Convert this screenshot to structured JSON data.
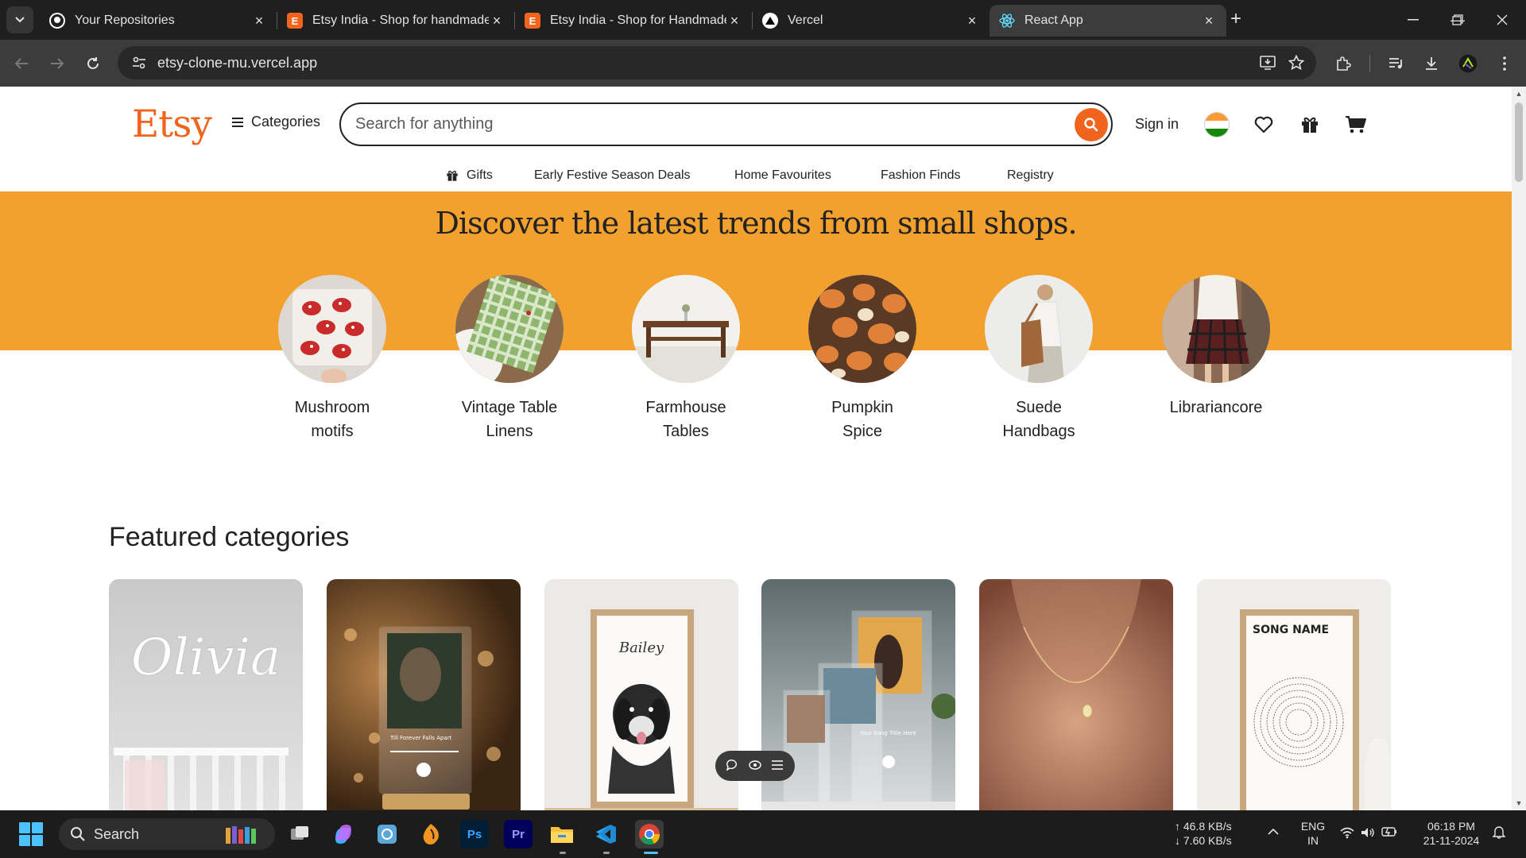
{
  "browser": {
    "tabs": [
      {
        "title": "Your Repositories",
        "favicon": "github-icon",
        "active": false
      },
      {
        "title": "Etsy India - Shop for handmade",
        "favicon": "etsy-icon",
        "active": false
      },
      {
        "title": "Etsy India - Shop for Handmade",
        "favicon": "etsy-icon",
        "active": false
      },
      {
        "title": "Vercel",
        "favicon": "vercel-icon",
        "active": false
      },
      {
        "title": "React App",
        "favicon": "react-icon",
        "active": true
      }
    ],
    "url": "etsy-clone-mu.vercel.app"
  },
  "header": {
    "logo": "Etsy",
    "categories_label": "Categories",
    "search_placeholder": "Search for anything",
    "signin_label": "Sign in"
  },
  "subnav": {
    "items": [
      "Gifts",
      "Early Festive Season Deals",
      "Home Favourites",
      "Fashion Finds",
      "Registry"
    ]
  },
  "hero": {
    "title": "Discover the latest trends from small shops.",
    "trends": [
      {
        "line1": "Mushroom",
        "line2": "motifs"
      },
      {
        "line1": "Vintage Table",
        "line2": "Linens"
      },
      {
        "line1": "Farmhouse",
        "line2": "Tables"
      },
      {
        "line1": "Pumpkin",
        "line2": "Spice"
      },
      {
        "line1": "Suede",
        "line2": "Handbags"
      },
      {
        "line1": "Librariancore",
        "line2": ""
      }
    ]
  },
  "featured": {
    "title": "Featured categories",
    "cards": [
      {
        "name": "name-sign",
        "overlay_text": "Olivia"
      },
      {
        "name": "song-plaque-couple",
        "overlay_text": "Till Forever Falls Apart"
      },
      {
        "name": "pet-portrait",
        "overlay_text": "Bailey"
      },
      {
        "name": "photo-plaques",
        "overlay_text": "Your Song Title Here"
      },
      {
        "name": "necklace",
        "overlay_text": ""
      },
      {
        "name": "song-lyrics-print",
        "overlay_text": "SONG NAME"
      }
    ]
  },
  "taskbar": {
    "search_label": "Search",
    "net_up": "↑ 46.8 KB/s",
    "net_down": "↓ 7.60 KB/s",
    "lang_line1": "ENG",
    "lang_line2": "IN",
    "time": "06:18 PM",
    "date": "21-11-2024"
  },
  "colors": {
    "etsy_orange": "#f1641e",
    "hero_bg": "#f2a12e"
  }
}
